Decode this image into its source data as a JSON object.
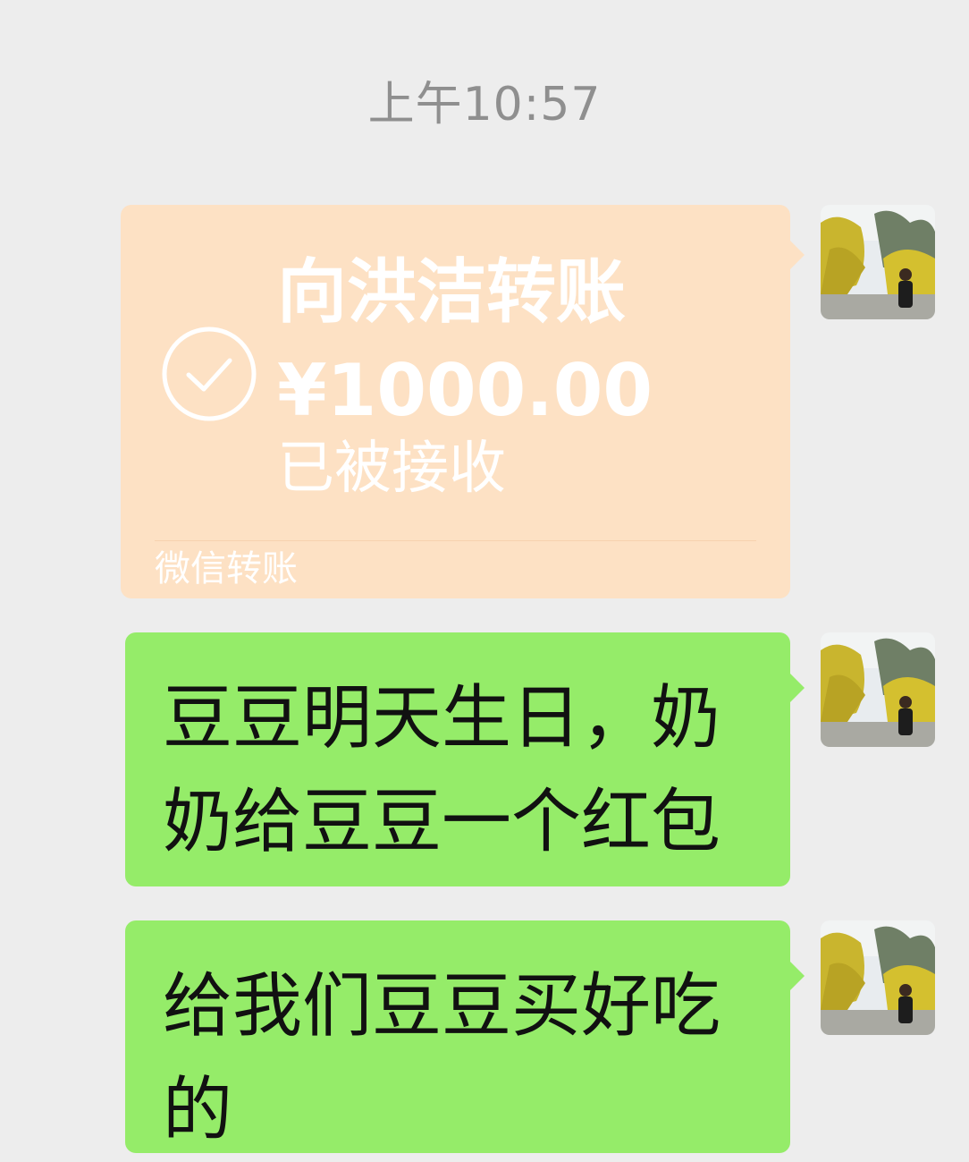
{
  "chat": {
    "timestamp": "上午10:57",
    "transfer": {
      "title": "向洪洁转账",
      "amount": "¥1000.00",
      "status": "已被接收",
      "footer": "微信转账",
      "icon": "check-circle-icon",
      "colors": {
        "card": "#fde1c4",
        "text": "#ffffff"
      }
    },
    "messages": [
      {
        "text": "豆豆明天生日，奶奶给豆豆一个红包"
      },
      {
        "text": "给我们豆豆买好吃的"
      }
    ],
    "colors": {
      "background": "#ededed",
      "bubble": "#95ec69",
      "timestamp": "#8f8f8f"
    },
    "avatar": {
      "icon": "user-avatar-photo"
    }
  }
}
